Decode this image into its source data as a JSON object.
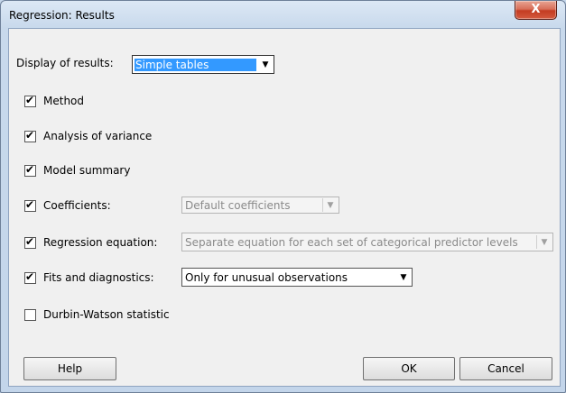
{
  "window": {
    "title": "Regression: Results",
    "close_glyph": "X"
  },
  "display": {
    "label": "Display of results:",
    "value": "Simple tables"
  },
  "options": {
    "method": {
      "label": "Method",
      "checked": true
    },
    "anova": {
      "label": "Analysis of variance",
      "checked": true
    },
    "model_summary": {
      "label": "Model summary",
      "checked": true
    },
    "coefficients": {
      "label": "Coefficients:",
      "checked": true,
      "select_value": "Default coefficients"
    },
    "regression_equation": {
      "label": "Regression equation:",
      "checked": true,
      "select_value": "Separate equation for each set of categorical predictor levels"
    },
    "fits": {
      "label": "Fits and diagnostics:",
      "checked": true,
      "select_value": "Only for unusual observations"
    },
    "durbin_watson": {
      "label": "Durbin-Watson statistic",
      "checked": false
    }
  },
  "buttons": {
    "help": "Help",
    "ok": "OK",
    "cancel": "Cancel"
  },
  "glyphs": {
    "check": "✔",
    "arrow": "▼"
  }
}
